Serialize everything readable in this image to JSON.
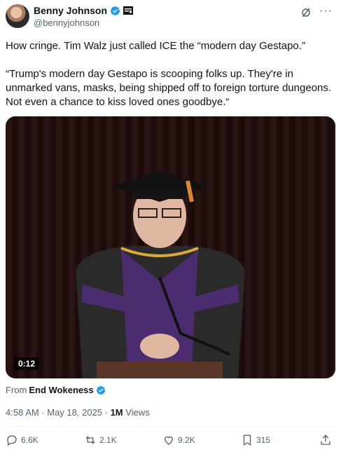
{
  "author": {
    "name": "Benny Johnson",
    "handle": "@bennyjohnson"
  },
  "tweet": {
    "line1": "How cringe. Tim Walz just called ICE the “modern day Gestapo.”",
    "line2": "“Trump's modern day Gestapo is scooping folks up. They're in unmarked vans, masks, being shipped off to foreign torture dungeons. Not even a chance to kiss loved ones goodbye.“"
  },
  "video": {
    "timestamp": "0:12"
  },
  "source": {
    "prefix": "From",
    "name": "End Wokeness"
  },
  "meta": {
    "time": "4:58 AM · May 18, 2025 · ",
    "views": "1M",
    "views_label": " Views"
  },
  "actions": {
    "replies": "6.6K",
    "reposts": "2.1K",
    "likes": "9.2K",
    "bookmarks": "315"
  },
  "colors": {
    "verified": "#1d9bf0",
    "text": "#0f1419",
    "secondary": "#536471"
  }
}
